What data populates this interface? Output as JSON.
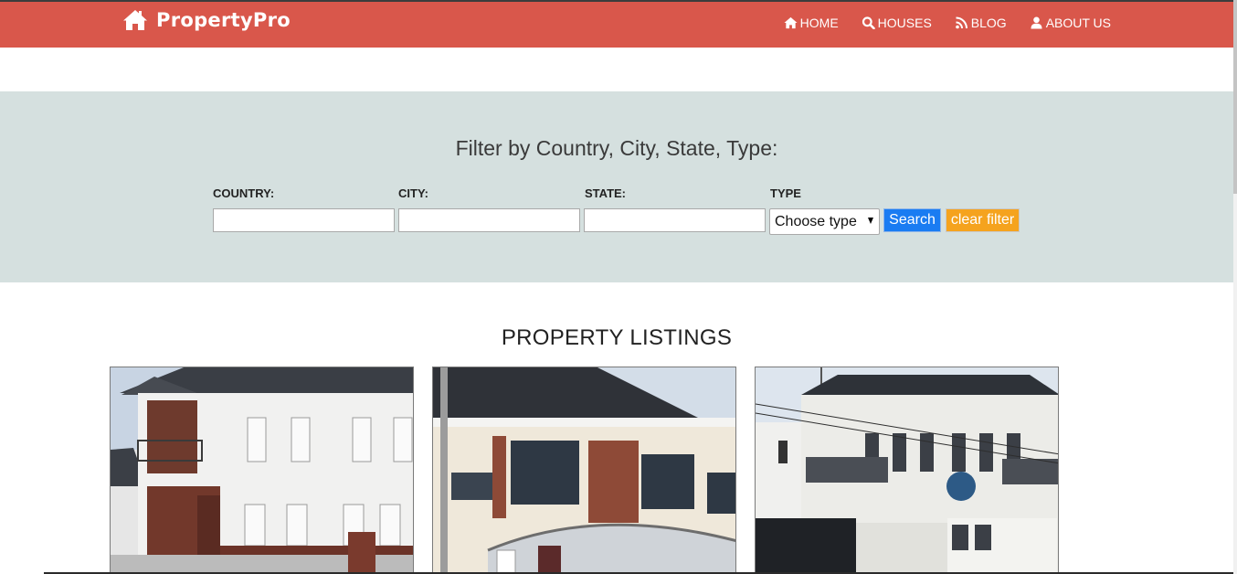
{
  "brand": {
    "name": "PropertyPro",
    "icon": "home-icon"
  },
  "nav": {
    "items": [
      {
        "label": "HOME",
        "icon": "home-icon"
      },
      {
        "label": "HOUSES",
        "icon": "search-icon"
      },
      {
        "label": "BLOG",
        "icon": "rss-icon"
      },
      {
        "label": "ABOUT US",
        "icon": "user-icon"
      }
    ]
  },
  "filter": {
    "title": "Filter by Country, City, State, Type:",
    "fields": {
      "country": {
        "label": "COUNTRY:",
        "value": ""
      },
      "city": {
        "label": "CITY:",
        "value": ""
      },
      "state": {
        "label": "STATE:",
        "value": ""
      },
      "type": {
        "label": "TYPE",
        "selected": "Choose type"
      }
    },
    "search_label": "Search",
    "clear_label": "clear filter"
  },
  "listings": {
    "title": "PROPERTY LISTINGS",
    "cards": [
      {
        "image": "house-photo"
      },
      {
        "image": "house-photo"
      },
      {
        "image": "house-photo"
      }
    ]
  },
  "colors": {
    "header": "#d9574b",
    "filter_band": "#d5e0df",
    "search_button": "#1a7cf2",
    "clear_button": "#f5a31e"
  }
}
